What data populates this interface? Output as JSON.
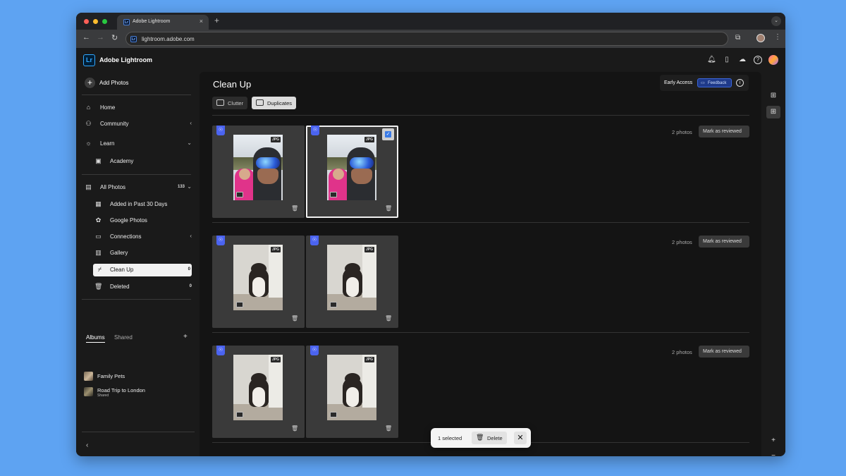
{
  "browser": {
    "tab_title": "Adobe Lightroom",
    "tab_favicon": "Lr",
    "url": "lightroom.adobe.com",
    "new_tab": "+",
    "close_tab": "×"
  },
  "app": {
    "logo": "Lr",
    "title": "Adobe Lightroom",
    "header_icons": [
      "bell-icon",
      "devices-icon",
      "cloud-icon",
      "help-icon",
      "profile-avatar"
    ]
  },
  "sidebar": {
    "add_photos": "Add Photos",
    "nav": [
      {
        "label": "Home",
        "icon": "home-icon"
      },
      {
        "label": "Community",
        "icon": "community-icon",
        "chevron": "‹"
      },
      {
        "label": "Learn",
        "icon": "lightbulb-icon",
        "chevron": "⌄"
      },
      {
        "label": "Academy",
        "icon": "academy-icon"
      }
    ],
    "library": [
      {
        "label": "All Photos",
        "icon": "photos-icon",
        "count": "133",
        "chevron": "⌄"
      },
      {
        "label": "Added in Past 30 Days",
        "icon": "calendar-icon"
      },
      {
        "label": "Google Photos",
        "icon": "pinwheel-icon"
      },
      {
        "label": "Connections",
        "icon": "connections-icon",
        "chevron": "‹"
      },
      {
        "label": "Gallery",
        "icon": "gallery-icon"
      },
      {
        "label": "Clean Up",
        "icon": "broom-icon",
        "count": "0"
      },
      {
        "label": "Deleted",
        "icon": "trash-icon",
        "count": "0"
      }
    ],
    "album_tabs": {
      "albums": "Albums",
      "shared": "Shared",
      "add": "+"
    },
    "albums": [
      {
        "name": "Family Pets",
        "sub": ""
      },
      {
        "name": "Road Trip to London",
        "sub": "Shared"
      }
    ],
    "collapse": "‹"
  },
  "main": {
    "title": "Clean Up",
    "early_access": "Early Access",
    "feedback": "Feedback",
    "segments": {
      "clutter": "Clutter",
      "duplicates": "Duplicates",
      "selected": "Duplicates"
    },
    "groups": [
      {
        "count_label": "2 photos",
        "action": "Mark as reviewed",
        "photo": "ski-selfie",
        "photos": [
          {
            "format": "JPG",
            "selected": false
          },
          {
            "format": "JPG",
            "selected": true
          }
        ]
      },
      {
        "count_label": "2 photos",
        "action": "Mark as reviewed",
        "photo": "cat",
        "photos": [
          {
            "format": "JPG",
            "selected": false
          },
          {
            "format": "JPG",
            "selected": false
          }
        ]
      },
      {
        "count_label": "2 photos",
        "action": "Mark as reviewed",
        "photo": "cat",
        "photos": [
          {
            "format": "JPG",
            "selected": false
          },
          {
            "format": "JPG",
            "selected": false
          }
        ]
      }
    ]
  },
  "toast": {
    "selected": "1 selected",
    "delete": "Delete",
    "close": "✕"
  },
  "colors": {
    "background": "#5ea3f2",
    "accent": "#4b64f0",
    "feedback": "#1f3a8a",
    "checkbox": "#3b7be6"
  }
}
